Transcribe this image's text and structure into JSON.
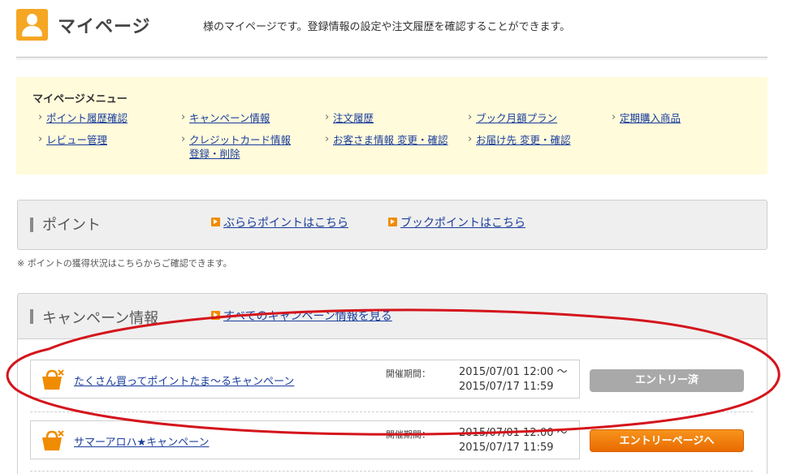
{
  "header": {
    "title": "マイページ",
    "description": "様のマイページです。登録情報の設定や注文履歴を確認することができます。",
    "icon": "user-icon"
  },
  "menu": {
    "title": "マイページメニュー",
    "items": [
      {
        "label": "ポイント履歴確認"
      },
      {
        "label": "キャンペーン情報"
      },
      {
        "label": "注文履歴"
      },
      {
        "label": "ブック月額プラン"
      },
      {
        "label": "定期購入商品"
      },
      {
        "label": "レビュー管理"
      },
      {
        "label": "クレジットカード情報",
        "label2": "登録・削除"
      },
      {
        "label": "お客さま情報 変更・確認"
      },
      {
        "label": "お届け先 変更・確認"
      }
    ]
  },
  "points": {
    "title": "ポイント",
    "link1": "ぶららポイントはこちら",
    "link2": "ブックポイントはこちら",
    "note": "※ ポイントの獲得状況はこちらからご確認できます。"
  },
  "campaigns": {
    "title": "キャンペーン情報",
    "all_link": "すべてのキャンペーン情報を見る",
    "items": [
      {
        "name": "たくさん買ってポイントたま～るキャンペーン",
        "period_label": "開催期間：",
        "period_start": "2015/07/01 12:00 ～",
        "period_end": "2015/07/17 11:59",
        "button": "エントリー済",
        "status": "entered"
      },
      {
        "name": "サマーアロハ★キャンペーン",
        "period_label": "開催期間：",
        "period_start": "2015/07/01 12:00 ～",
        "period_end": "2015/07/17 11:59",
        "button": "エントリーページへ",
        "status": "open"
      }
    ]
  },
  "colors": {
    "accent_orange": "#f08c00",
    "menu_bg": "#fffbdb",
    "link": "#1a3d9c",
    "annotation_red": "#d4141c"
  }
}
